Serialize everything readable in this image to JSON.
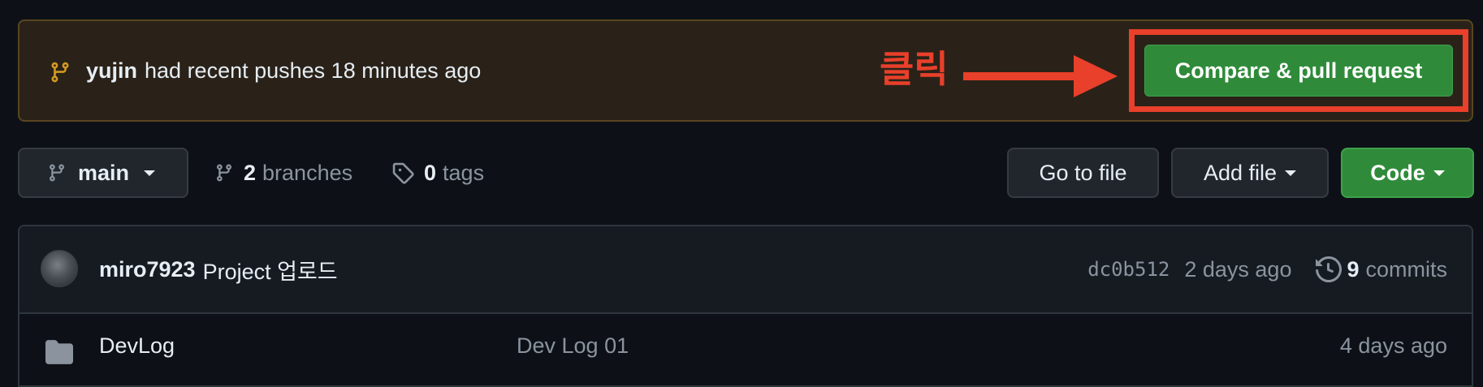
{
  "banner": {
    "user": "yujin",
    "message": "had recent pushes 18 minutes ago",
    "button_label": "Compare & pull request",
    "branch_icon": "git-branch-icon"
  },
  "annotation": {
    "label": "클릭",
    "color": "#e8402a"
  },
  "toolbar": {
    "branch_name": "main",
    "branches_count": "2",
    "branches_label": "branches",
    "tags_count": "0",
    "tags_label": "tags",
    "go_to_file_label": "Go to file",
    "add_file_label": "Add file",
    "code_label": "Code"
  },
  "latest_commit": {
    "author": "miro7923",
    "message": "Project 업로드",
    "sha": "dc0b512",
    "time": "2 days ago",
    "commits_count": "9",
    "commits_label": "commits"
  },
  "files": [
    {
      "name": "DevLog",
      "message": "Dev Log 01",
      "date": "4 days ago",
      "icon": "folder-icon"
    }
  ],
  "colors": {
    "background": "#0d1117",
    "primary_button": "#2f8b3a",
    "banner_background": "#2a2219",
    "banner_icon": "#d29922"
  }
}
